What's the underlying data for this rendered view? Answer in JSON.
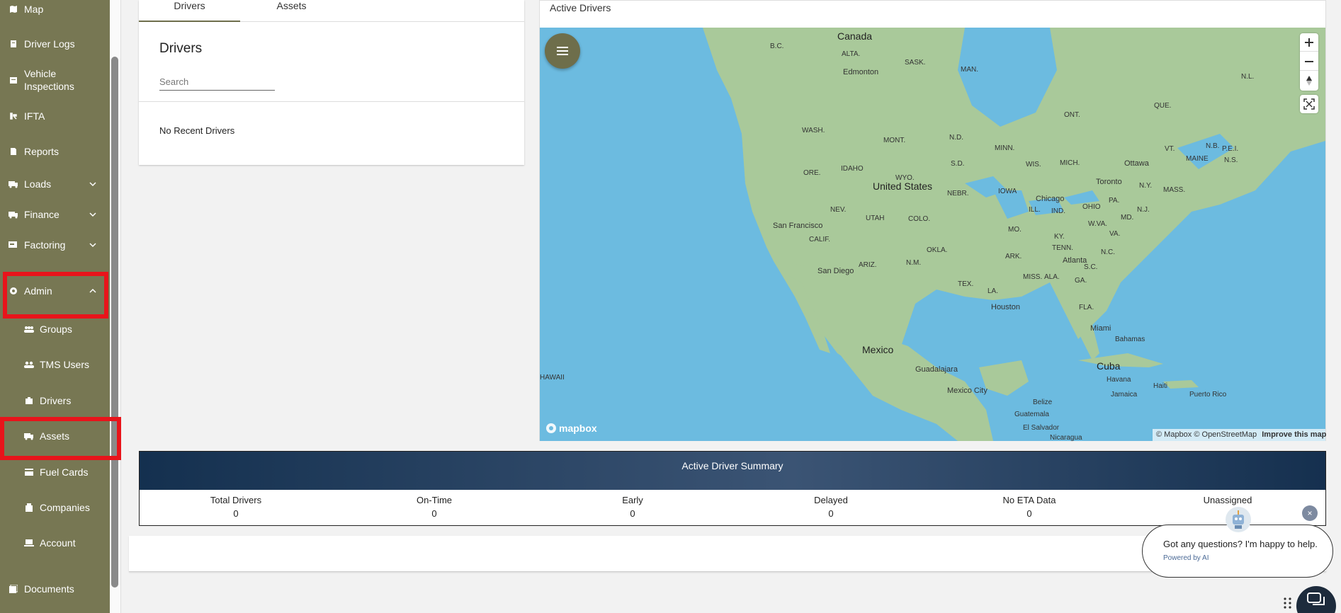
{
  "sidebar": {
    "items": [
      {
        "label": "Map",
        "icon": "map-icon"
      },
      {
        "label": "Driver Logs",
        "icon": "clipboard-icon"
      },
      {
        "label": "Vehicle\nInspections",
        "icon": "inspection-icon"
      },
      {
        "label": "IFTA",
        "icon": "fuel-tax-icon"
      },
      {
        "label": "Reports",
        "icon": "report-icon"
      },
      {
        "label": "Loads",
        "icon": "truck-icon"
      },
      {
        "label": "Finance",
        "icon": "truck-icon"
      },
      {
        "label": "Factoring",
        "icon": "factoring-icon"
      },
      {
        "label": "Admin",
        "icon": "gear-icon"
      },
      {
        "label": "Groups",
        "icon": "groups-icon"
      },
      {
        "label": "TMS Users",
        "icon": "users-icon"
      },
      {
        "label": "Drivers",
        "icon": "driver-icon"
      },
      {
        "label": "Assets",
        "icon": "truck-icon"
      },
      {
        "label": "Fuel Cards",
        "icon": "card-icon"
      },
      {
        "label": "Companies",
        "icon": "building-icon"
      },
      {
        "label": "Account",
        "icon": "laptop-icon"
      },
      {
        "label": "Documents",
        "icon": "documents-icon"
      }
    ]
  },
  "tabs": [
    {
      "label": "Drivers",
      "active": true
    },
    {
      "label": "Assets",
      "active": false
    }
  ],
  "drivers_panel": {
    "title": "Drivers",
    "search_placeholder": "Search",
    "empty_text": "No Recent Drivers"
  },
  "map": {
    "title": "Active Drivers",
    "logo": "mapbox",
    "attribution": "© Mapbox © OpenStreetMap",
    "improve_link": "Improve this map",
    "labels": {
      "countries": [
        "Canada",
        "United States",
        "Mexico",
        "Cuba"
      ],
      "regions": [
        "B.C.",
        "ALTA.",
        "SASK.",
        "MAN.",
        "N.L.",
        "ONT.",
        "QUE.",
        "WASH.",
        "MONT.",
        "N.D.",
        "MINN.",
        "N.B.",
        "P.E.I.",
        "N.S.",
        "MAINE",
        "VT.",
        "N.Y.",
        "MASS.",
        "ORE.",
        "IDAHO",
        "WYO.",
        "S.D.",
        "WIS.",
        "MICH.",
        "NEBR.",
        "IOWA",
        "PA.",
        "N.J.",
        "NEV.",
        "UTAH",
        "COLO.",
        "ILL.",
        "IND.",
        "OHIO",
        "MD.",
        "W.VA.",
        "VA.",
        "CALIF.",
        "MO.",
        "KY.",
        "TENN.",
        "N.C.",
        "ARIZ.",
        "N.M.",
        "OKLA.",
        "ARK.",
        "S.C.",
        "MISS.",
        "ALA.",
        "GA.",
        "TEX.",
        "LA.",
        "FLA.",
        "HAWAII"
      ],
      "cities": [
        "Edmonton",
        "Ottawa",
        "Toronto",
        "Chicago",
        "San Francisco",
        "San Diego",
        "Atlanta",
        "Houston",
        "Miami",
        "Bahamas",
        "Guadalajara",
        "Mexico City",
        "Havana",
        "Haiti",
        "Jamaica",
        "Puerto Rico",
        "Belize",
        "Guatemala",
        "El Salvador",
        "Nicaragua"
      ]
    }
  },
  "summary": {
    "title": "Active Driver Summary",
    "stats": [
      {
        "label": "Total Drivers",
        "value": "0"
      },
      {
        "label": "On-Time",
        "value": "0"
      },
      {
        "label": "Early",
        "value": "0"
      },
      {
        "label": "Delayed",
        "value": "0"
      },
      {
        "label": "No ETA Data",
        "value": "0"
      },
      {
        "label": "Unassigned",
        "value": ""
      }
    ]
  },
  "chat": {
    "question": "Got any questions? I'm happy to help.",
    "powered_by": "Powered by AI",
    "close": "×"
  },
  "colors": {
    "sidebar": "#777753",
    "highlight": "#e8141b",
    "summary_header": "#1f3a5c",
    "map_water": "#6cbbe0",
    "map_land": "#a9c99a"
  }
}
